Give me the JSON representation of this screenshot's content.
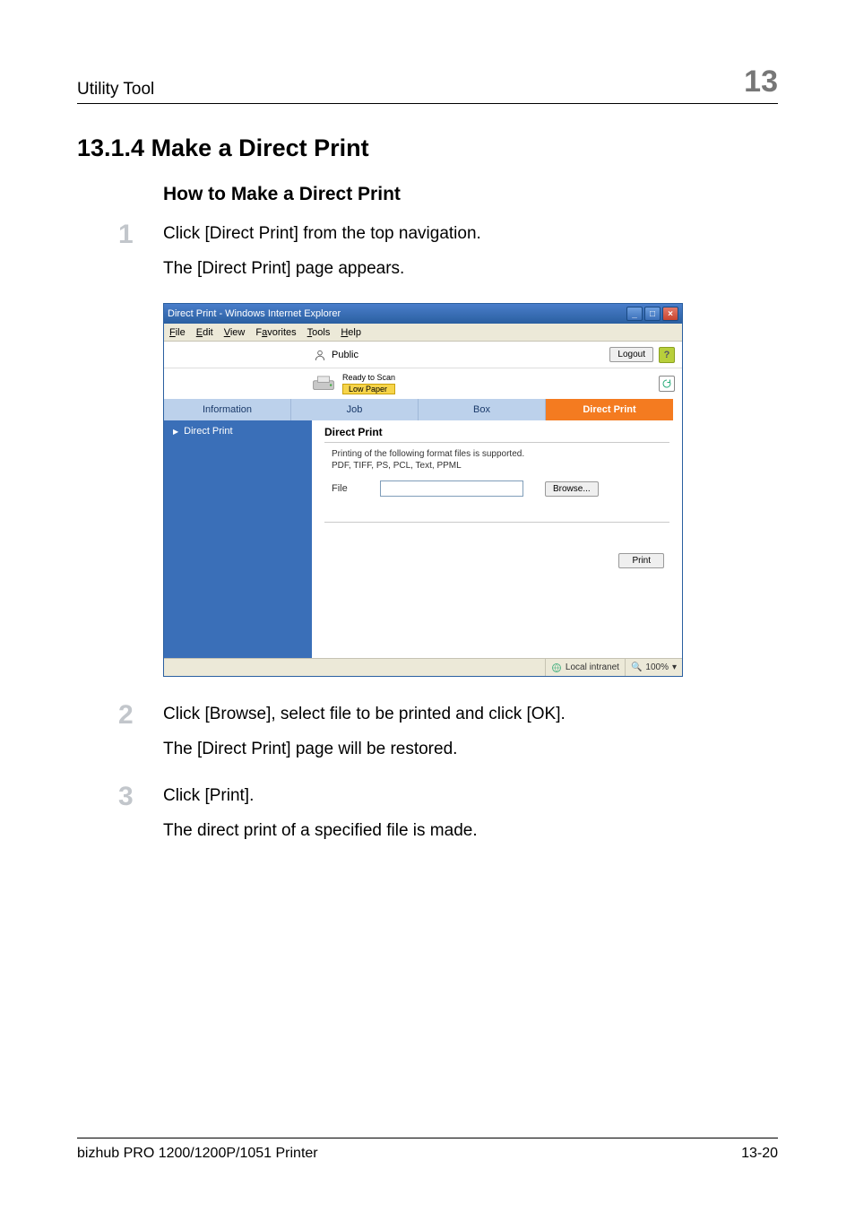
{
  "header": {
    "left": "Utility Tool",
    "right": "13"
  },
  "h2": "13.1.4  Make a Direct Print",
  "h3": "How to Make a Direct Print",
  "steps": {
    "s1": {
      "num": "1",
      "line1": "Click [Direct Print] from the top navigation.",
      "line2": "The [Direct Print] page appears."
    },
    "s2": {
      "num": "2",
      "line1": "Click [Browse], select file to be printed and click [OK].",
      "line2": "The [Direct Print] page will be restored."
    },
    "s3": {
      "num": "3",
      "line1": "Click [Print].",
      "line2": "The direct print of a specified file is made."
    }
  },
  "screenshot": {
    "title": "Direct Print - Windows Internet Explorer",
    "menu": {
      "file": "File",
      "edit": "Edit",
      "view": "View",
      "favorites": "Favorites",
      "tools": "Tools",
      "help": "Help"
    },
    "user": "Public",
    "logout": "Logout",
    "help": "?",
    "status_ready": "Ready to Scan",
    "status_low": "Low Paper",
    "tabs": {
      "information": "Information",
      "job": "Job",
      "box": "Box",
      "direct": "Direct Print"
    },
    "sidebar_item": "Direct Print",
    "content_title": "Direct Print",
    "content_desc1": "Printing of the following format files is supported.",
    "content_desc2": "PDF, TIFF, PS, PCL, Text, PPML",
    "file_label": "File",
    "browse": "Browse...",
    "print": "Print",
    "status_zone": "Local intranet",
    "status_zoom": "100%"
  },
  "footer": {
    "left": "bizhub PRO 1200/1200P/1051 Printer",
    "right": "13-20"
  }
}
